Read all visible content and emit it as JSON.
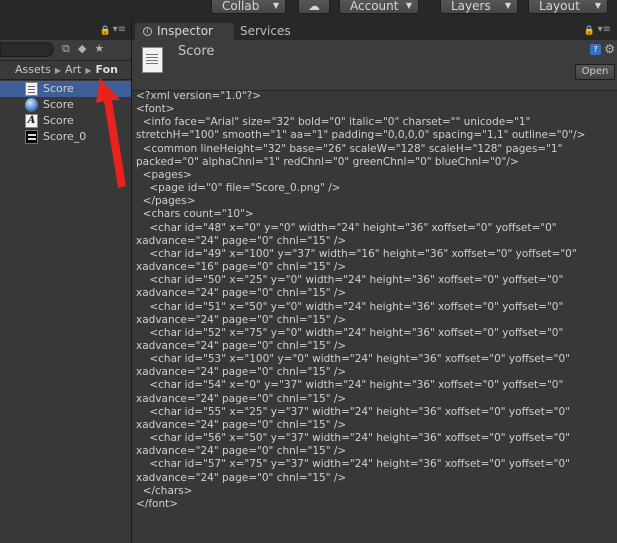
{
  "toolbar": {
    "collab": "Collab",
    "account": "Account",
    "layers": "Layers",
    "layout": "Layout"
  },
  "project": {
    "breadcrumb": [
      "Assets",
      "Art",
      "Fon"
    ],
    "items": [
      {
        "label": "Score",
        "icon": "text-asset-icon",
        "selected": true
      },
      {
        "label": "Score",
        "icon": "material-sphere-icon",
        "selected": false
      },
      {
        "label": "Score",
        "icon": "font-asset-icon",
        "selected": false
      },
      {
        "label": "Score_0",
        "icon": "texture-icon",
        "selected": false
      }
    ]
  },
  "inspector": {
    "tab_inspector": "Inspector",
    "tab_services": "Services",
    "asset_name": "Score",
    "open_button": "Open",
    "content": "<?xml version=\"1.0\"?>\n<font>\n  <info face=\"Arial\" size=\"32\" bold=\"0\" italic=\"0\" charset=\"\" unicode=\"1\"\nstretchH=\"100\" smooth=\"1\" aa=\"1\" padding=\"0,0,0,0\" spacing=\"1,1\" outline=\"0\"/>\n  <common lineHeight=\"32\" base=\"26\" scaleW=\"128\" scaleH=\"128\" pages=\"1\"\npacked=\"0\" alphaChnl=\"1\" redChnl=\"0\" greenChnl=\"0\" blueChnl=\"0\"/>\n  <pages>\n    <page id=\"0\" file=\"Score_0.png\" />\n  </pages>\n  <chars count=\"10\">\n    <char id=\"48\" x=\"0\" y=\"0\" width=\"24\" height=\"36\" xoffset=\"0\" yoffset=\"0\"\nxadvance=\"24\" page=\"0\" chnl=\"15\" />\n    <char id=\"49\" x=\"100\" y=\"37\" width=\"16\" height=\"36\" xoffset=\"0\" yoffset=\"0\"\nxadvance=\"16\" page=\"0\" chnl=\"15\" />\n    <char id=\"50\" x=\"25\" y=\"0\" width=\"24\" height=\"36\" xoffset=\"0\" yoffset=\"0\"\nxadvance=\"24\" page=\"0\" chnl=\"15\" />\n    <char id=\"51\" x=\"50\" y=\"0\" width=\"24\" height=\"36\" xoffset=\"0\" yoffset=\"0\"\nxadvance=\"24\" page=\"0\" chnl=\"15\" />\n    <char id=\"52\" x=\"75\" y=\"0\" width=\"24\" height=\"36\" xoffset=\"0\" yoffset=\"0\"\nxadvance=\"24\" page=\"0\" chnl=\"15\" />\n    <char id=\"53\" x=\"100\" y=\"0\" width=\"24\" height=\"36\" xoffset=\"0\" yoffset=\"0\"\nxadvance=\"24\" page=\"0\" chnl=\"15\" />\n    <char id=\"54\" x=\"0\" y=\"37\" width=\"24\" height=\"36\" xoffset=\"0\" yoffset=\"0\"\nxadvance=\"24\" page=\"0\" chnl=\"15\" />\n    <char id=\"55\" x=\"25\" y=\"37\" width=\"24\" height=\"36\" xoffset=\"0\" yoffset=\"0\"\nxadvance=\"24\" page=\"0\" chnl=\"15\" />\n    <char id=\"56\" x=\"50\" y=\"37\" width=\"24\" height=\"36\" xoffset=\"0\" yoffset=\"0\"\nxadvance=\"24\" page=\"0\" chnl=\"15\" />\n    <char id=\"57\" x=\"75\" y=\"37\" width=\"24\" height=\"36\" xoffset=\"0\" yoffset=\"0\"\nxadvance=\"24\" page=\"0\" chnl=\"15\" />\n  </chars>\n</font>"
  },
  "colors": {
    "selection": "#3e5f96",
    "annotation_arrow": "#e8221d",
    "panel_bg": "#383838"
  }
}
